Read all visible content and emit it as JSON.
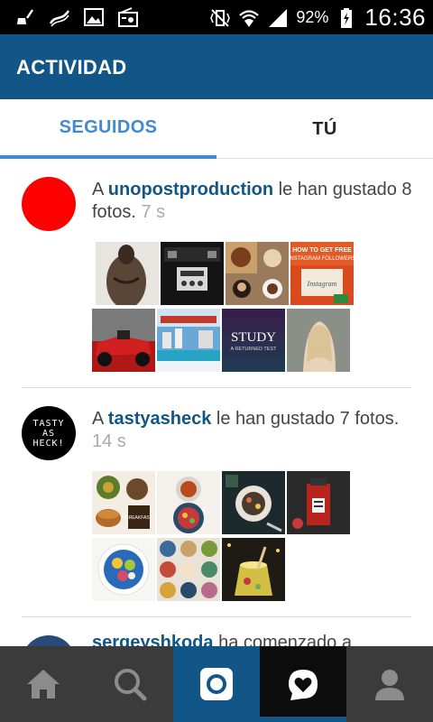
{
  "status_bar": {
    "battery_percent": "92%",
    "time": "16:36"
  },
  "app_bar": {
    "title": "ACTIVIDAD"
  },
  "tabs": [
    {
      "label": "SEGUIDOS",
      "selected": true
    },
    {
      "label": "TÚ",
      "selected": false
    }
  ],
  "feed": [
    {
      "avatar_color": "#ff0000",
      "prefix": "A ",
      "username": "unopostproduction",
      "action": " le han gustado 8 fotos.",
      "time": "7 s",
      "photo_count": 8
    },
    {
      "avatar_text": "TASTY AS HECK!",
      "prefix": "A ",
      "username": "tastyasheck",
      "action": " le han gustado 7 fotos.",
      "time": "14 s",
      "photo_count": 7
    },
    {
      "username": "sergeyshkoda",
      "action": " ha comenzado a"
    }
  ],
  "thumb_texts": {
    "study_title": "STUDY",
    "study_sub": "A RETURNED TEST",
    "how_to": "HOW TO GET FREE INSTAGRAM FOLLOWERS",
    "instagram": "Instagram",
    "breakfast_sign": "BREAKFAST"
  },
  "colors": {
    "accent": "#125688",
    "tab_active": "#3f8ad0",
    "nav_bg": "#3b3b3b"
  },
  "nav_icons": [
    "home-icon",
    "search-icon",
    "camera-icon",
    "activity-heart-icon",
    "profile-icon"
  ]
}
